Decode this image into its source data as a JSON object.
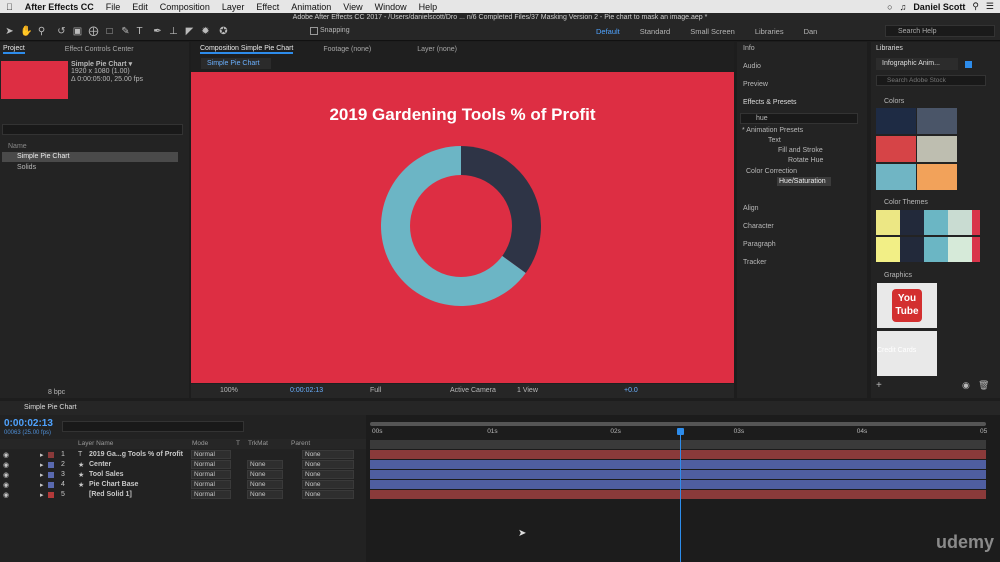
{
  "menubar": {
    "app": "After Effects CC",
    "items": [
      "File",
      "Edit",
      "Composition",
      "Layer",
      "Effect",
      "Animation",
      "View",
      "Window",
      "Help"
    ],
    "user": "Daniel Scott"
  },
  "window_title": "Adobe After Effects CC 2017 - /Users/danielscott/Dro ... n/6 Completed Files/37 Masking Version 2 - Pie chart to mask an image.aep *",
  "toolbar": {
    "snapping": "Snapping",
    "workspaces": [
      "Default",
      "Standard",
      "Small Screen",
      "Libraries",
      "Dan"
    ],
    "search_placeholder": "Search Help"
  },
  "project": {
    "tabs": [
      "Project",
      "Effect Controls Center"
    ],
    "comp_name": "Simple Pie Chart ▾",
    "comp_res": "1920 x 1080 (1.00)",
    "comp_duration": "Δ 0:00:05:00, 25.00 fps",
    "name_header": "Name",
    "items": [
      "Simple Pie Chart",
      "Solids"
    ],
    "bpc": "8 bpc"
  },
  "viewer": {
    "tabs": [
      "Composition Simple Pie Chart",
      "Footage (none)",
      "Layer (none)"
    ],
    "comp_tab": "Simple Pie Chart",
    "chart_title": "2019 Gardening Tools % of Profit",
    "zoom": "100%",
    "time": "0:00:02:13",
    "resolution": "Full",
    "camera": "Active Camera",
    "views": "1 View",
    "exposure": "+0.0"
  },
  "right_panels": {
    "info": "Info",
    "audio": "Audio",
    "preview": "Preview",
    "effects_presets": "Effects & Presets",
    "search_value": "hue",
    "tree": [
      "* Animation Presets",
      "Text",
      "Fill and Stroke",
      "Rotate Hue",
      "Color Correction",
      "Hue/Saturation"
    ],
    "align": "Align",
    "character": "Character",
    "paragraph": "Paragraph",
    "tracker": "Tracker"
  },
  "libraries": {
    "title": "Libraries",
    "library": "Infographic Anim...",
    "search_placeholder": "Search Adobe Stock",
    "colors": "Colors",
    "color_themes": "Color Themes",
    "graphics": "Graphics",
    "youtube": "You",
    "tube": "Tube",
    "credit": "Credit Cards",
    "swatches": [
      "#1e2b44",
      "#4a5568",
      "#d64447",
      "#bebeb0",
      "#70b5c4",
      "#f2a25a"
    ],
    "themes": [
      [
        "#ece784",
        "#22293a",
        "#6bb6c4",
        "#c9dcd2",
        "#d9344a"
      ],
      [
        "#f2ef86",
        "#22293a",
        "#6bb6c4",
        "#d6ead9",
        "#d9344a"
      ]
    ]
  },
  "timeline": {
    "tab": "Simple Pie Chart",
    "timecode": "0:00:02:13",
    "frame_info": "00063 (25.00 fps)",
    "headers": {
      "layer_name": "Layer Name",
      "mode": "Mode",
      "t": "T",
      "trkmat": "TrkMat",
      "parent": "Parent"
    },
    "ruler": [
      "00s",
      "01s",
      "02s",
      "03s",
      "04s",
      "05"
    ],
    "layers": [
      {
        "num": "1",
        "name": "2019 Ga...g Tools % of Profit",
        "type": "T",
        "color": "#8a3a3a",
        "mode": "Normal",
        "trkmat": "",
        "parent": "None"
      },
      {
        "num": "2",
        "name": "Center",
        "type": "★",
        "color": "#5a6ab0",
        "mode": "Normal",
        "trkmat": "None",
        "parent": "None"
      },
      {
        "num": "3",
        "name": "Tool Sales",
        "type": "★",
        "color": "#5a6ab0",
        "mode": "Normal",
        "trkmat": "None",
        "parent": "None"
      },
      {
        "num": "4",
        "name": "Pie Chart Base",
        "type": "★",
        "color": "#5a6ab0",
        "mode": "Normal",
        "trkmat": "None",
        "parent": "None"
      },
      {
        "num": "5",
        "name": "[Red Solid 1]",
        "type": "",
        "color": "#b33a3a",
        "mode": "Normal",
        "trkmat": "None",
        "parent": "None"
      }
    ]
  },
  "chart_data": {
    "type": "pie",
    "title": "2019 Gardening Tools % of Profit",
    "values": [
      35,
      65
    ],
    "colors": [
      "#2e3446",
      "#6cb5c5"
    ]
  },
  "watermark": "udemy"
}
